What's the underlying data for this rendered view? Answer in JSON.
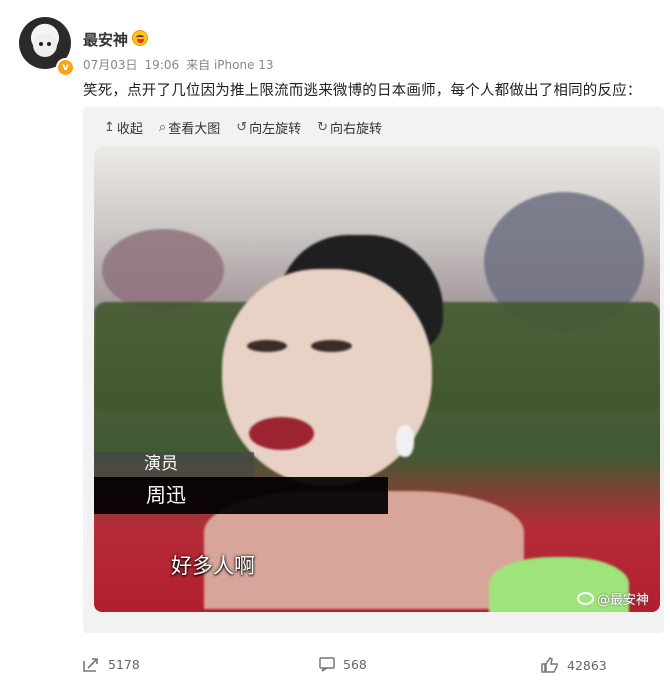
{
  "post": {
    "username": "最安神",
    "date": "07月03日",
    "time": "19:06",
    "source": "来自 iPhone 13",
    "text": "笑死，点开了几位因为推上限流而逃来微博的日本画师，每个人都做出了相同的反应："
  },
  "toolbar": {
    "collapse": "收起",
    "view_full": "查看大图",
    "rotate_left": "向左旋转",
    "rotate_right": "向右旋转",
    "collapse_icon": "up-arrow-icon",
    "view_full_icon": "magnifier-icon",
    "rotate_left_icon": "rotate-left-icon",
    "rotate_right_icon": "rotate-right-icon"
  },
  "image": {
    "caption_role": "演员",
    "caption_name": "周迅",
    "subtitle": "好多人啊",
    "watermark": "@最安神"
  },
  "actions": {
    "reposts": "5178",
    "comments": "568",
    "likes": "42863"
  },
  "colors": {
    "accent": "#f7a51f",
    "text": "#333333",
    "meta": "#888888"
  }
}
